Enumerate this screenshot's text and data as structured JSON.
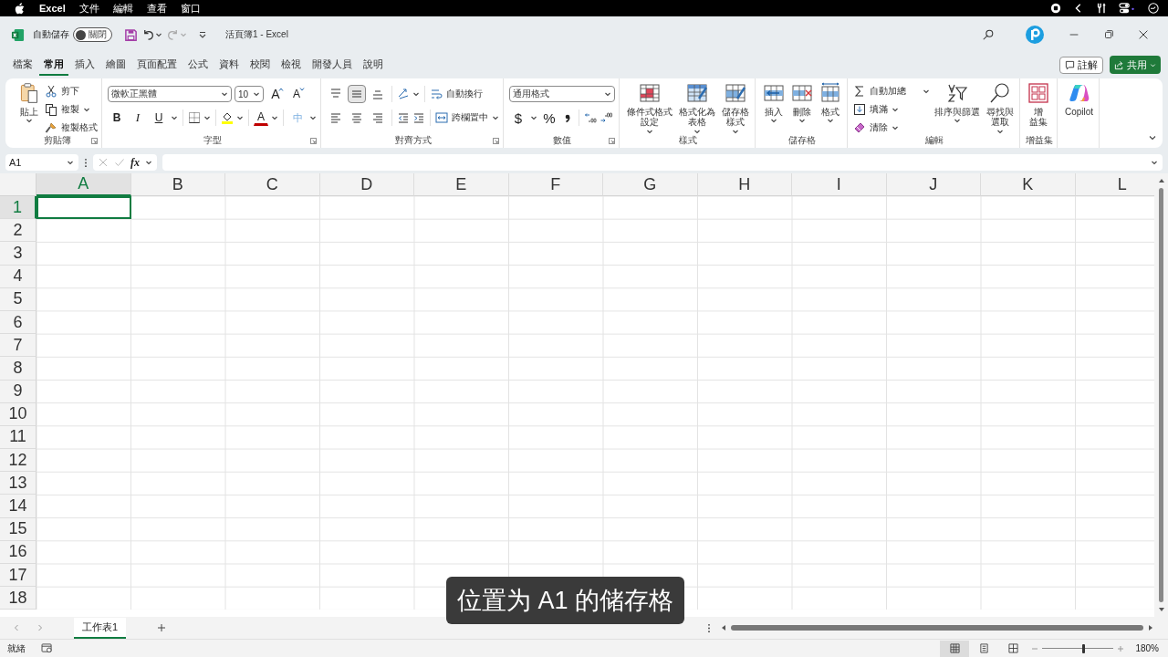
{
  "menu_bar": {
    "items": [
      "Excel",
      "文件",
      "編輯",
      "查看",
      "窗口"
    ]
  },
  "title_bar": {
    "autosave_label": "自動儲存",
    "autosave": {
      "on": false,
      "label": "關閉"
    },
    "title": "活頁簿1 - Excel"
  },
  "ribbon_tabs": [
    {
      "label": "檔案",
      "selected": false
    },
    {
      "label": "常用",
      "selected": true
    },
    {
      "label": "插入",
      "selected": false
    },
    {
      "label": "繪圖",
      "selected": false
    },
    {
      "label": "頁面配置",
      "selected": false
    },
    {
      "label": "公式",
      "selected": false
    },
    {
      "label": "資料",
      "selected": false
    },
    {
      "label": "校閱",
      "selected": false
    },
    {
      "label": "檢視",
      "selected": false
    },
    {
      "label": "開發人員",
      "selected": false
    },
    {
      "label": "說明",
      "selected": false
    }
  ],
  "ribbon_actions": {
    "comments": "註解",
    "share": "共用"
  },
  "ribbon": {
    "clipboard": {
      "name": "剪貼簿",
      "paste": "貼上",
      "cut": "剪下",
      "copy": "複製",
      "format_painter": "複製格式"
    },
    "font": {
      "name": "字型",
      "font_name": "微軟正黑體",
      "font_size": "10",
      "grow": "A",
      "shrink": "A",
      "bold": "B",
      "italic": "I",
      "underline": "U",
      "font_color": "A",
      "phonetic": "中"
    },
    "alignment": {
      "name": "對齊方式",
      "vertical": [
        {
          "selected": false
        },
        {
          "selected": true
        },
        {
          "selected": false
        }
      ],
      "horizontal": [
        {
          "selected": false
        },
        {
          "selected": false
        },
        {
          "selected": false
        }
      ],
      "wrap_text": "自動換行",
      "merge_center": "跨欄置中"
    },
    "number": {
      "name": "數值",
      "format": "通用格式",
      "currency": "$",
      "percent": "%"
    },
    "styles": {
      "name": "樣式",
      "buttons": [
        [
          "條件式格式",
          "設定"
        ],
        [
          "格式化為",
          "表格"
        ],
        [
          "儲存格",
          "樣式"
        ]
      ]
    },
    "cells": {
      "name": "儲存格",
      "buttons": [
        "插入",
        "刪除",
        "格式"
      ]
    },
    "editing": {
      "name": "編輯",
      "autosum": "自動加總",
      "fill": "填滿",
      "clear": "清除",
      "sort_filter": "排序與篩選",
      "find_select": [
        "尋找與",
        "選取"
      ]
    },
    "addins": {
      "name": "增益集",
      "button": [
        "增",
        "益集"
      ]
    },
    "copilot": "Copilot"
  },
  "formula_bar": {
    "name_box": "A1",
    "function_glyph": "fx"
  },
  "grid": {
    "columns": [
      {
        "label": "A",
        "selected": true
      },
      {
        "label": "B",
        "selected": false
      },
      {
        "label": "C",
        "selected": false
      },
      {
        "label": "D",
        "selected": false
      },
      {
        "label": "E",
        "selected": false
      },
      {
        "label": "F",
        "selected": false
      },
      {
        "label": "G",
        "selected": false
      },
      {
        "label": "H",
        "selected": false
      },
      {
        "label": "I",
        "selected": false
      },
      {
        "label": "J",
        "selected": false
      },
      {
        "label": "K",
        "selected": false
      },
      {
        "label": "L",
        "selected": false
      }
    ],
    "rows": [
      {
        "label": "1",
        "selected": true
      },
      {
        "label": "2",
        "selected": false
      },
      {
        "label": "3",
        "selected": false
      },
      {
        "label": "4",
        "selected": false
      },
      {
        "label": "5",
        "selected": false
      },
      {
        "label": "6",
        "selected": false
      },
      {
        "label": "7",
        "selected": false
      },
      {
        "label": "8",
        "selected": false
      },
      {
        "label": "9",
        "selected": false
      },
      {
        "label": "10",
        "selected": false
      },
      {
        "label": "11",
        "selected": false
      },
      {
        "label": "12",
        "selected": false
      },
      {
        "label": "13",
        "selected": false
      },
      {
        "label": "14",
        "selected": false
      },
      {
        "label": "15",
        "selected": false
      },
      {
        "label": "16",
        "selected": false
      },
      {
        "label": "17",
        "selected": false
      },
      {
        "label": "18",
        "selected": false
      }
    ]
  },
  "sheet_tabs": [
    {
      "label": "工作表1",
      "selected": true
    }
  ],
  "status_bar": {
    "status": "就緒",
    "views": [
      {
        "selected": true
      },
      {
        "selected": false
      },
      {
        "selected": false
      }
    ],
    "zoom": {
      "level": 0.58,
      "reading": "180%"
    }
  },
  "caption": "位置为 A1 的储存格"
}
